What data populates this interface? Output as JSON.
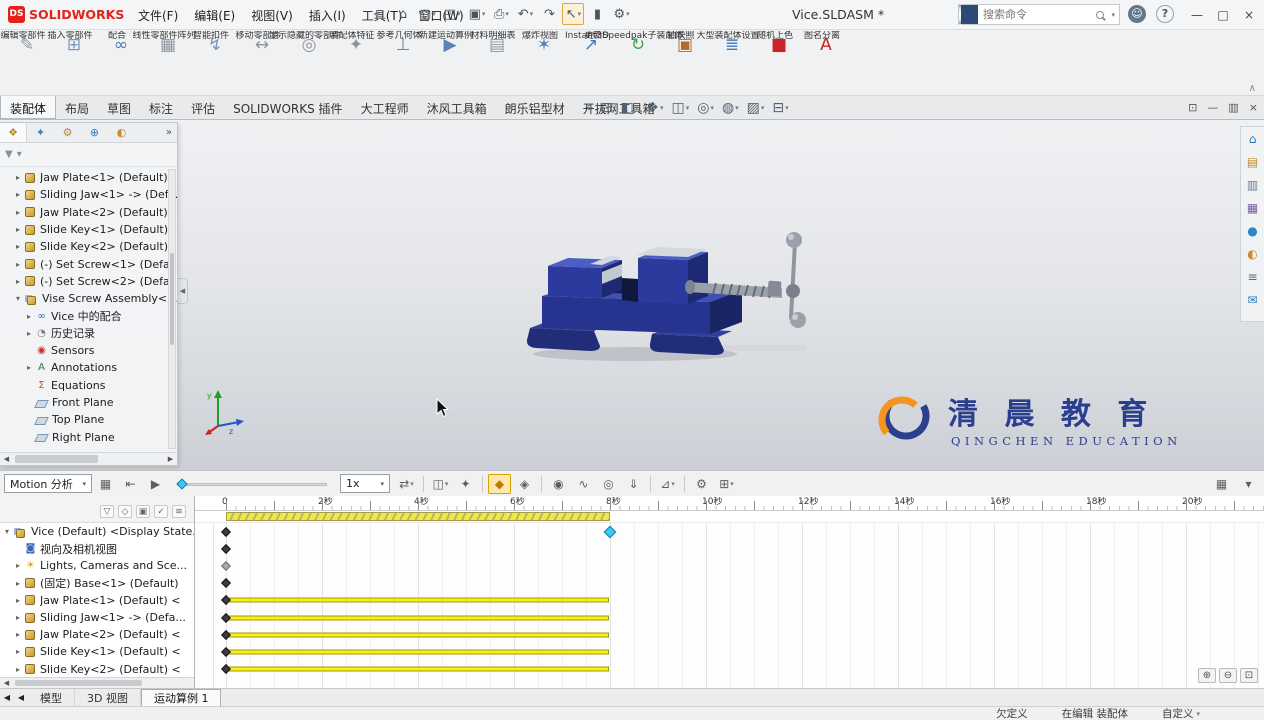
{
  "titlebar": {
    "logo_mark": "DS",
    "logo_text": "SOLIDWORKS",
    "menus": [
      "文件(F)",
      "编辑(E)",
      "视图(V)",
      "插入(I)",
      "工具(T)",
      "窗口(W)"
    ],
    "pin_glyph": "✦",
    "quick_access": [
      {
        "name": "home-icon",
        "glyph": "⌂"
      },
      {
        "name": "new-file-icon",
        "glyph": "▢",
        "caret": true
      },
      {
        "name": "open-file-icon",
        "glyph": "◰",
        "caret": true
      },
      {
        "name": "save-icon",
        "glyph": "▣",
        "caret": true
      },
      {
        "name": "print-icon",
        "glyph": "⎙",
        "caret": true
      },
      {
        "name": "undo-icon",
        "glyph": "↶",
        "caret": true
      },
      {
        "name": "redo-icon",
        "glyph": "↷"
      },
      {
        "name": "select-arrow-icon",
        "glyph": "↖",
        "caret": true,
        "selected": true
      },
      {
        "name": "marketplace-icon",
        "glyph": "▮"
      },
      {
        "name": "options-gear-icon",
        "glyph": "⚙",
        "caret": true
      }
    ],
    "title": "Vice.SLDASM *",
    "search_placeholder": "搜索命令",
    "user_glyph": "☺",
    "help_glyph": "?",
    "window_controls": [
      {
        "name": "minimize-button",
        "glyph": "—"
      },
      {
        "name": "maximize-button",
        "glyph": "□"
      },
      {
        "name": "close-button",
        "glyph": "×"
      }
    ]
  },
  "ribbon": {
    "collapse_glyph": "∧",
    "buttons": [
      {
        "name": "edit-component-button",
        "label": "编辑零部件",
        "glyph": "✎",
        "color": "#8e959c"
      },
      {
        "name": "insert-components-button",
        "label": "插入零部件",
        "glyph": "⊞",
        "color": "#7d97b9"
      },
      {
        "name": "mate-button",
        "label": "配合",
        "glyph": "∞",
        "color": "#4e79b8"
      },
      {
        "name": "linear-component-pattern-button",
        "label": "线性零部件阵列",
        "glyph": "▦",
        "color": "#8e959c"
      },
      {
        "name": "smart-fasteners-button",
        "label": "智能扣件",
        "glyph": "↯",
        "color": "#7d97b9"
      },
      {
        "name": "move-component-button",
        "label": "移动零部件",
        "glyph": "↔",
        "color": "#8e959c"
      },
      {
        "name": "show-hidden-components-button",
        "label": "显示隐藏的零部件",
        "glyph": "◎",
        "color": "#8e959c"
      },
      {
        "name": "assembly-features-button",
        "label": "装配体特征",
        "glyph": "✦",
        "color": "#8e959c"
      },
      {
        "name": "reference-geometry-button",
        "label": "参考几何体",
        "glyph": "⊥",
        "color": "#6a87a8"
      },
      {
        "name": "new-motion-study-button",
        "label": "新建运动算例",
        "glyph": "▶",
        "color": "#5b83b5"
      },
      {
        "name": "bill-of-materials-button",
        "label": "材料明细表",
        "glyph": "▤",
        "color": "#8e959c"
      },
      {
        "name": "exploded-view-button",
        "label": "爆炸视图",
        "glyph": "✶",
        "color": "#5b83b5"
      },
      {
        "name": "instant3d-button",
        "label": "Instant3D",
        "glyph": "↗",
        "color": "#3f7ac0"
      },
      {
        "name": "update-speedpak-button",
        "label": "更新Speedpak子装配体",
        "glyph": "↻",
        "color": "#3f9e4d"
      },
      {
        "name": "take-snapshot-button",
        "label": "拍快照",
        "glyph": "▣",
        "color": "#b06c2a"
      },
      {
        "name": "large-assembly-settings-button",
        "label": "大型装配体设置",
        "glyph": "≣",
        "color": "#3f7ac0"
      },
      {
        "name": "random-color-button",
        "label": "随机上色",
        "glyph": "■",
        "color": "#cc2229"
      },
      {
        "name": "detach-name-button",
        "label": "图名分离",
        "glyph": "A",
        "color": "#cc2229"
      }
    ]
  },
  "tabs": {
    "active_index": 0,
    "items": [
      "装配体",
      "布局",
      "草图",
      "标注",
      "评估",
      "SOLIDWORKS 插件",
      "大工程师",
      "沐风工具箱",
      "朗乐铝型材",
      "开拔网工具箱"
    ]
  },
  "view_toolbar": [
    {
      "name": "zoom-fit-icon",
      "glyph": "⌖"
    },
    {
      "name": "zoom-area-icon",
      "glyph": "⊡"
    },
    {
      "name": "section-view-icon",
      "glyph": "◧",
      "caret": true
    },
    {
      "name": "view-orientation-icon",
      "glyph": "❖",
      "caret": true
    },
    {
      "name": "display-style-icon",
      "glyph": "◫",
      "caret": true
    },
    {
      "name": "hide-show-items-icon",
      "glyph": "◎",
      "caret": true
    },
    {
      "name": "edit-appearance-icon",
      "glyph": "◍",
      "caret": true
    },
    {
      "name": "apply-scene-icon",
      "glyph": "▨",
      "caret": true
    },
    {
      "name": "view-settings-icon",
      "glyph": "⊟",
      "caret": true
    }
  ],
  "mdi_controls": [
    {
      "name": "doc-restore-icon",
      "glyph": "⊡"
    },
    {
      "name": "doc-minimize-icon",
      "glyph": "—"
    },
    {
      "name": "doc-tile-icon",
      "glyph": "▥"
    },
    {
      "name": "doc-close-icon",
      "glyph": "×"
    }
  ],
  "feature_panel": {
    "tabs": [
      {
        "name": "featuremanager-tab-icon",
        "glyph": "❖",
        "color": "#b98a2e"
      },
      {
        "name": "propertymanager-tab-icon",
        "glyph": "✦",
        "color": "#3f7ac0"
      },
      {
        "name": "configurationmanager-tab-icon",
        "glyph": "⚙",
        "color": "#b98a2e"
      },
      {
        "name": "dimxpertmanager-tab-icon",
        "glyph": "⊕",
        "color": "#3f7ac0"
      },
      {
        "name": "displaymanager-tab-icon",
        "glyph": "◐",
        "color": "#d08a2a"
      }
    ],
    "expand_glyph": "»",
    "filter_glyph": "▼",
    "collapse_glyph": "◀",
    "hscroll_glyphs": [
      "◀",
      "▶"
    ],
    "items": [
      {
        "label": "Jaw Plate<1> (Default)",
        "icon": "part-icon",
        "arrow": "right",
        "indent": 1
      },
      {
        "label": "Sliding Jaw<1> -> (Def...",
        "icon": "part-icon",
        "arrow": "right",
        "indent": 1
      },
      {
        "label": "Jaw Plate<2> (Default)",
        "icon": "part-icon",
        "arrow": "right",
        "indent": 1
      },
      {
        "label": "Slide Key<1> (Default)",
        "icon": "part-icon",
        "arrow": "right",
        "indent": 1
      },
      {
        "label": "Slide Key<2> (Default)",
        "icon": "part-icon",
        "arrow": "right",
        "indent": 1
      },
      {
        "label": "(-) Set Screw<1> (Defau...",
        "icon": "part-icon",
        "arrow": "right",
        "indent": 1
      },
      {
        "label": "(-) Set Screw<2> (Defau...",
        "icon": "part-icon",
        "arrow": "right",
        "indent": 1
      },
      {
        "label": "Vise Screw Assembly<1...",
        "icon": "assembly-icon",
        "arrow": "down",
        "indent": 1
      },
      {
        "label": "Vice 中的配合",
        "icon": "mates-icon",
        "arrow": "right",
        "indent": 2
      },
      {
        "label": "历史记录",
        "icon": "history-icon",
        "arrow": "right",
        "indent": 2
      },
      {
        "label": "Sensors",
        "icon": "sensors-icon",
        "arrow": "",
        "indent": 2
      },
      {
        "label": "Annotations",
        "icon": "annotations-icon",
        "arrow": "right",
        "indent": 2
      },
      {
        "label": "Equations",
        "icon": "equations-icon",
        "arrow": "",
        "indent": 2
      },
      {
        "label": "Front Plane",
        "icon": "plane-icon",
        "arrow": "",
        "indent": 2
      },
      {
        "label": "Top Plane",
        "icon": "plane-icon",
        "arrow": "",
        "indent": 2
      },
      {
        "label": "Right Plane",
        "icon": "plane-icon",
        "arrow": "",
        "indent": 2
      }
    ]
  },
  "icon_map": {
    "part-icon": {
      "style": "part"
    },
    "assembly-icon": {
      "style": "asm"
    },
    "camera-icon": {
      "glyph": "◙",
      "color": "#3a66b0"
    },
    "light-icon": {
      "glyph": "☀",
      "color": "#d8a11b"
    },
    "mates-icon": {
      "glyph": "∞",
      "color": "#3a66b0"
    },
    "history-icon": {
      "glyph": "◔",
      "color": "#777777"
    },
    "sensors-icon": {
      "glyph": "◉",
      "color": "#bb3333"
    },
    "annotations-icon": {
      "glyph": "A",
      "color": "#2a7a3f"
    },
    "equations-icon": {
      "glyph": "Σ",
      "color": "#c05a00"
    },
    "plane-icon": {
      "style": "plane"
    }
  },
  "viewport": {
    "watermark": {
      "cn": "清 晨 教 育",
      "en": "QINGCHEN EDUCATION"
    },
    "triad_labels": {
      "y": "y",
      "z": "z"
    }
  },
  "taskpane": [
    {
      "name": "resources-home-icon",
      "glyph": "⌂",
      "color": "#2e74b5"
    },
    {
      "name": "design-library-icon",
      "glyph": "▤",
      "color": "#c08a2e"
    },
    {
      "name": "file-explorer-icon",
      "glyph": "▥",
      "color": "#6a7f94"
    },
    {
      "name": "view-palette-icon",
      "glyph": "▦",
      "color": "#7a5ea0"
    },
    {
      "name": "appearances-icon",
      "glyph": "●",
      "color": "#2e86c8"
    },
    {
      "name": "scenes-icon",
      "glyph": "◐",
      "color": "#d08a2a"
    },
    {
      "name": "custom-properties-icon",
      "glyph": "≡",
      "color": "#5a6b7d"
    },
    {
      "name": "forum-icon",
      "glyph": "✉",
      "color": "#2e74b5"
    }
  ],
  "motion": {
    "study_type": "Motion 分析",
    "speed": "1x",
    "time_bar": [
      0,
      8
    ],
    "ruler_labels": [
      "0",
      "2秒",
      "4秒",
      "6秒",
      "8秒",
      "10秒",
      "12秒",
      "14秒",
      "16秒",
      "18秒",
      "20秒"
    ],
    "toolbar": [
      {
        "name": "calculate-icon",
        "glyph": "▦"
      },
      {
        "name": "play-from-start-icon",
        "glyph": "⇤"
      },
      {
        "name": "play-icon",
        "glyph": "▶"
      },
      {
        "type": "slider"
      },
      {
        "type": "speed-select"
      },
      {
        "name": "playback-mode-icon",
        "glyph": "⇄",
        "caret": true
      },
      {
        "type": "sep"
      },
      {
        "name": "save-animation-icon",
        "glyph": "◫",
        "caret": true
      },
      {
        "name": "animation-wizard-icon",
        "glyph": "✦"
      },
      {
        "type": "sep"
      },
      {
        "name": "autokey-icon",
        "glyph": "◆",
        "highlight": true
      },
      {
        "name": "add-key-icon",
        "glyph": "◈"
      },
      {
        "type": "sep"
      },
      {
        "name": "motor-icon",
        "glyph": "◉"
      },
      {
        "name": "spring-icon",
        "glyph": "∿"
      },
      {
        "name": "contact-icon",
        "glyph": "◎"
      },
      {
        "name": "gravity-icon",
        "glyph": "⇓"
      },
      {
        "type": "sep"
      },
      {
        "name": "results-icon",
        "glyph": "⊿",
        "caret": true
      },
      {
        "type": "sep"
      },
      {
        "name": "study-properties-icon",
        "glyph": "⚙"
      },
      {
        "name": "simulation-setup-icon",
        "glyph": "⊞",
        "caret": true
      }
    ],
    "toolbar_right": [
      {
        "name": "timeline-grid-icon",
        "glyph": "▦"
      },
      {
        "name": "motionbar-collapse-icon",
        "glyph": "▾"
      }
    ],
    "filter_icons": [
      {
        "name": "motion-filter-all-icon",
        "glyph": "▽"
      },
      {
        "name": "motion-filter-animated-icon",
        "glyph": "◇"
      },
      {
        "name": "motion-filter-driving-icon",
        "glyph": "▣"
      },
      {
        "name": "motion-filter-selected-icon",
        "glyph": "✓"
      },
      {
        "name": "motion-filter-results-icon",
        "glyph": "≋"
      }
    ],
    "zoom_icons": [
      {
        "name": "timeline-zoom-in-icon",
        "glyph": "⊕"
      },
      {
        "name": "timeline-zoom-out-icon",
        "glyph": "⊖"
      },
      {
        "name": "timeline-zoom-fit-icon",
        "glyph": "⊡"
      }
    ],
    "hscroll_glyph": "◀",
    "rows": [
      {
        "label": "Vice (Default) <Display State...",
        "icon": "assembly-icon",
        "arrow": "down",
        "indent": 0,
        "keys": [
          {
            "t": 0,
            "color": "dark"
          },
          {
            "t": 8,
            "color": "selected"
          }
        ]
      },
      {
        "label": "视向及相机视图",
        "icon": "camera-icon",
        "arrow": "",
        "indent": 1,
        "keys": [
          {
            "t": 0,
            "color": "dark"
          }
        ]
      },
      {
        "label": "Lights, Cameras and Sce...",
        "icon": "light-icon",
        "arrow": "right",
        "indent": 1,
        "keys": [
          {
            "t": 0,
            "color": "gray"
          }
        ]
      },
      {
        "label": "(固定) Base<1> (Default)",
        "icon": "part-icon",
        "arrow": "right",
        "indent": 1,
        "keys": [
          {
            "t": 0,
            "color": "dark"
          }
        ]
      },
      {
        "label": "Jaw Plate<1> (Default) <",
        "icon": "part-icon",
        "arrow": "right",
        "indent": 1,
        "keys": [
          {
            "t": 0,
            "color": "dark"
          }
        ],
        "bar": [
          0,
          8
        ]
      },
      {
        "label": "Sliding Jaw<1> -> (Defa...",
        "icon": "part-icon",
        "arrow": "right",
        "indent": 1,
        "keys": [
          {
            "t": 0,
            "color": "dark"
          }
        ],
        "bar": [
          0,
          8
        ]
      },
      {
        "label": "Jaw Plate<2> (Default) <",
        "icon": "part-icon",
        "arrow": "right",
        "indent": 1,
        "keys": [
          {
            "t": 0,
            "color": "dark"
          }
        ],
        "bar": [
          0,
          8
        ]
      },
      {
        "label": "Slide Key<1> (Default) <",
        "icon": "part-icon",
        "arrow": "right",
        "indent": 1,
        "keys": [
          {
            "t": 0,
            "color": "dark"
          }
        ],
        "bar": [
          0,
          8
        ]
      },
      {
        "label": "Slide Key<2> (Default) <",
        "icon": "part-icon",
        "arrow": "right",
        "indent": 1,
        "keys": [
          {
            "t": 0,
            "color": "dark"
          }
        ],
        "bar": [
          0,
          8
        ]
      }
    ]
  },
  "bottom_tabs": {
    "nav_glyphs": [
      "◀",
      "◀"
    ],
    "active_index": 2,
    "items": [
      "模型",
      "3D 视图",
      "运动算例 1"
    ]
  },
  "statusbar": {
    "items": [
      {
        "label": "欠定义"
      },
      {
        "label": "在编辑 装配体"
      },
      {
        "label": "自定义",
        "caret": true
      }
    ]
  }
}
